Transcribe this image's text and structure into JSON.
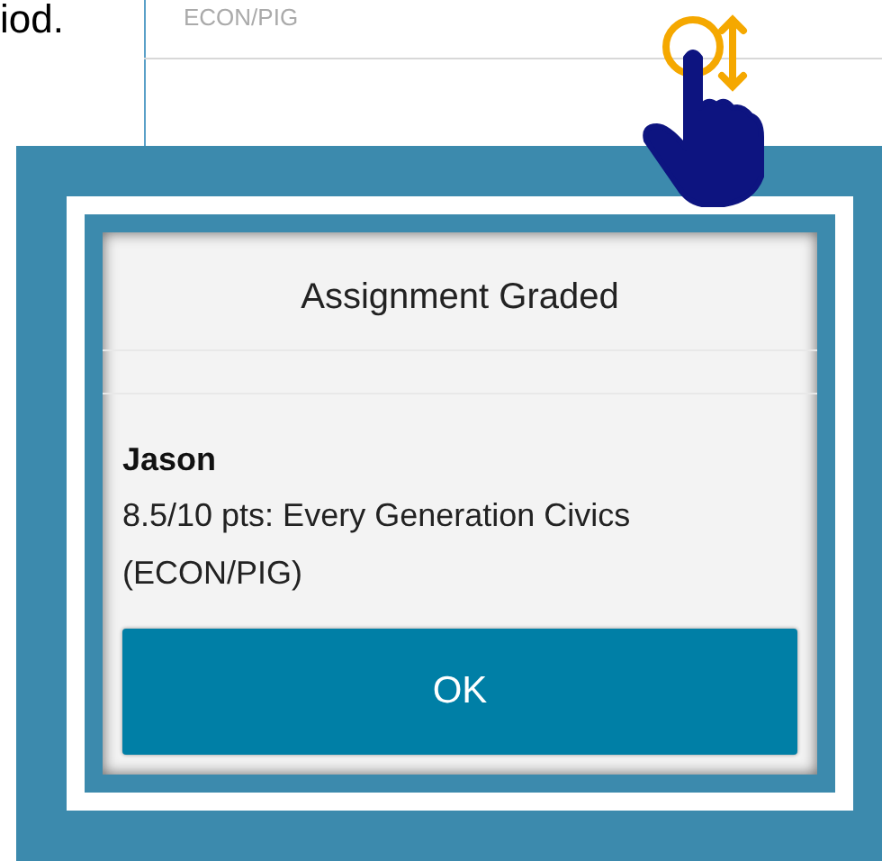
{
  "background": {
    "cut_text": "iod.",
    "row_subtitle": "ECON/PIG"
  },
  "dialog": {
    "title": "Assignment Graded",
    "student": "Jason",
    "message": "8.5/10 pts: Every Generation Civics (ECON/PIG)",
    "buttons": [
      "OK"
    ]
  }
}
